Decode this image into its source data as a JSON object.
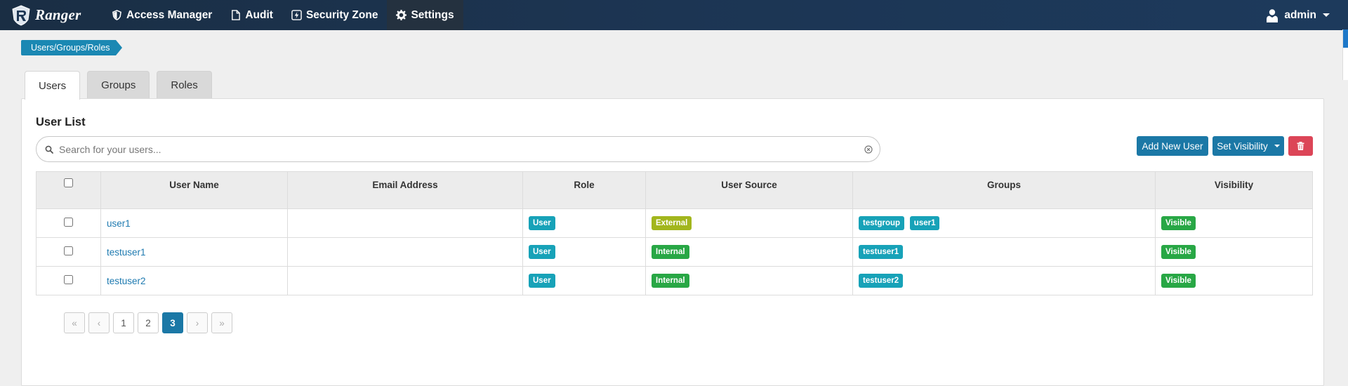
{
  "app": {
    "brand": "Ranger"
  },
  "nav": {
    "items": [
      {
        "label": "Access Manager",
        "icon": "shield-icon"
      },
      {
        "label": "Audit",
        "icon": "file-icon"
      },
      {
        "label": "Security Zone",
        "icon": "bolt-icon"
      },
      {
        "label": "Settings",
        "icon": "gear-icon",
        "active": true
      }
    ],
    "user": "admin"
  },
  "breadcrumb": "Users/Groups/Roles",
  "tabs": [
    {
      "label": "Users",
      "active": true
    },
    {
      "label": "Groups"
    },
    {
      "label": "Roles"
    }
  ],
  "panel": {
    "title": "User List",
    "search_placeholder": "Search for your users...",
    "add_button": "Add New User",
    "visibility_button": "Set Visibility"
  },
  "table": {
    "columns": [
      "User Name",
      "Email Address",
      "Role",
      "User Source",
      "Groups",
      "Visibility"
    ],
    "rows": [
      {
        "name": "user1",
        "email": "",
        "role": "User",
        "source": "External",
        "groups": [
          "testgroup",
          "user1"
        ],
        "visibility": "Visible"
      },
      {
        "name": "testuser1",
        "email": "",
        "role": "User",
        "source": "Internal",
        "groups": [
          "testuser1"
        ],
        "visibility": "Visible"
      },
      {
        "name": "testuser2",
        "email": "",
        "role": "User",
        "source": "Internal",
        "groups": [
          "testuser2"
        ],
        "visibility": "Visible"
      }
    ]
  },
  "pagination": {
    "first": "«",
    "prev": "‹",
    "pages": [
      "1",
      "2",
      "3"
    ],
    "current": "3",
    "next": "›",
    "last": "»"
  },
  "colors": {
    "navbar": "#1c3553",
    "primary": "#1b78a6",
    "danger": "#dc4557",
    "badge_user": "#17a2b8",
    "badge_external": "#a2b61d",
    "badge_internal": "#28a745"
  }
}
